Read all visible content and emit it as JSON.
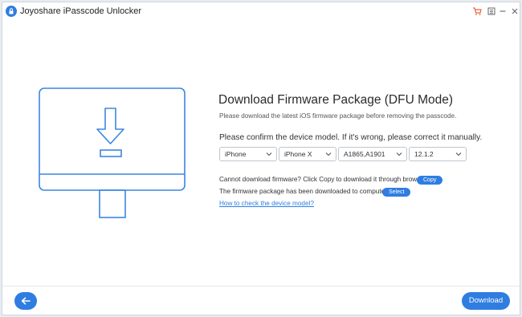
{
  "window": {
    "title": "Joyoshare iPasscode Unlocker",
    "icons": [
      "app-logo",
      "cart-icon",
      "menu-icon",
      "minimize-icon",
      "close-icon"
    ]
  },
  "main": {
    "heading": "Download Firmware Package (DFU Mode)",
    "subtext": "Please download the latest iOS firmware package before removing the passcode.",
    "confirm_text": "Please confirm the device model. If it's wrong, please correct it manually.",
    "selects": {
      "device": "iPhone",
      "model": "iPhone X",
      "model_code": "A1865,A1901",
      "ios_version": "12.1.2"
    },
    "copy_line": "Cannot download firmware? Click Copy to download it through browser.",
    "copy_button": "Copy",
    "downloaded_line": "The firmware package has been downloaded to computer.",
    "select_button": "Select",
    "help_link": "How to check the device model?"
  },
  "footer": {
    "download_button": "Download"
  },
  "colors": {
    "accent": "#2f7de1",
    "illustration": "#3b86e3"
  }
}
